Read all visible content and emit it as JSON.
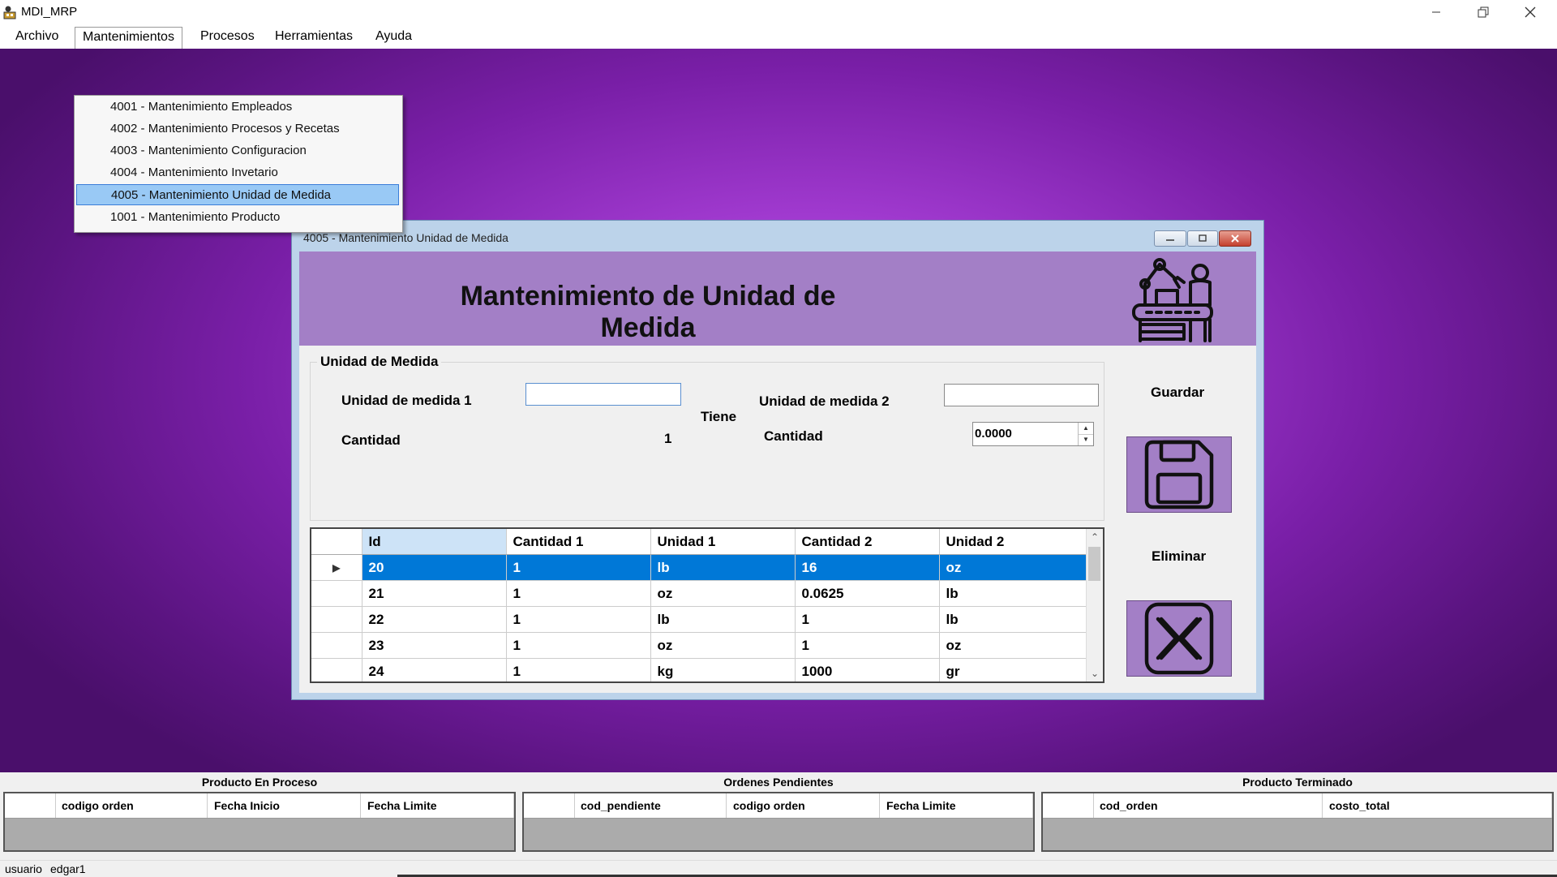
{
  "app": {
    "title": "MDI_MRP"
  },
  "menu": {
    "items": [
      "Archivo",
      "Mantenimientos",
      "Procesos",
      "Herramientas",
      "Ayuda"
    ],
    "open": "Mantenimientos",
    "dropdown": [
      "4001 - Mantenimiento Empleados",
      "4002 - Mantenimiento Procesos y Recetas",
      "4003 - Mantenimiento Configuracion",
      "4004 - Mantenimiento Invetario",
      "4005 - Mantenimiento Unidad de Medida",
      "1001 - Mantenimiento Producto"
    ],
    "selected_index": 4
  },
  "child_window": {
    "title": "4005 - Mantenimiento Unidad de Medida",
    "header_title": "Mantenimiento de Unidad de Medida",
    "group_title": "Unidad de Medida",
    "unidad1_label": "Unidad de medida 1",
    "unidad1_value": "",
    "cantidad1_label": "Cantidad",
    "cantidad1_value": "1",
    "tiene_label": "Tiene",
    "unidad2_label": "Unidad de medida 2",
    "unidad2_value": "",
    "cantidad2_label": "Cantidad",
    "cantidad2_value": "0.0000",
    "guardar_label": "Guardar",
    "eliminar_label": "Eliminar",
    "grid": {
      "columns": [
        "Id",
        "Cantidad 1",
        "Unidad 1",
        "Cantidad 2",
        "Unidad 2"
      ],
      "rows": [
        [
          "20",
          "1",
          "lb",
          "16",
          "oz"
        ],
        [
          "21",
          "1",
          "oz",
          "0.0625",
          "lb"
        ],
        [
          "22",
          "1",
          "lb",
          "1",
          "lb"
        ],
        [
          "23",
          "1",
          "oz",
          "1",
          "oz"
        ],
        [
          "24",
          "1",
          "kg",
          "1000",
          "gr"
        ]
      ],
      "selected_row": 0
    }
  },
  "bottom_panels": [
    {
      "title": "Producto En Proceso",
      "columns": [
        "codigo orden",
        "Fecha Inicio",
        "Fecha Limite"
      ]
    },
    {
      "title": "Ordenes Pendientes",
      "columns": [
        "cod_pendiente",
        "codigo orden",
        "Fecha Limite"
      ]
    },
    {
      "title": "Producto Terminado",
      "columns": [
        "cod_orden",
        "costo_total"
      ]
    }
  ],
  "status": {
    "user_label": "usuario",
    "user_value": "edgar1"
  },
  "colors": {
    "header_purple": "#a37fc6",
    "selection_blue": "#0078d7",
    "menu_highlight": "#99c9f5"
  }
}
